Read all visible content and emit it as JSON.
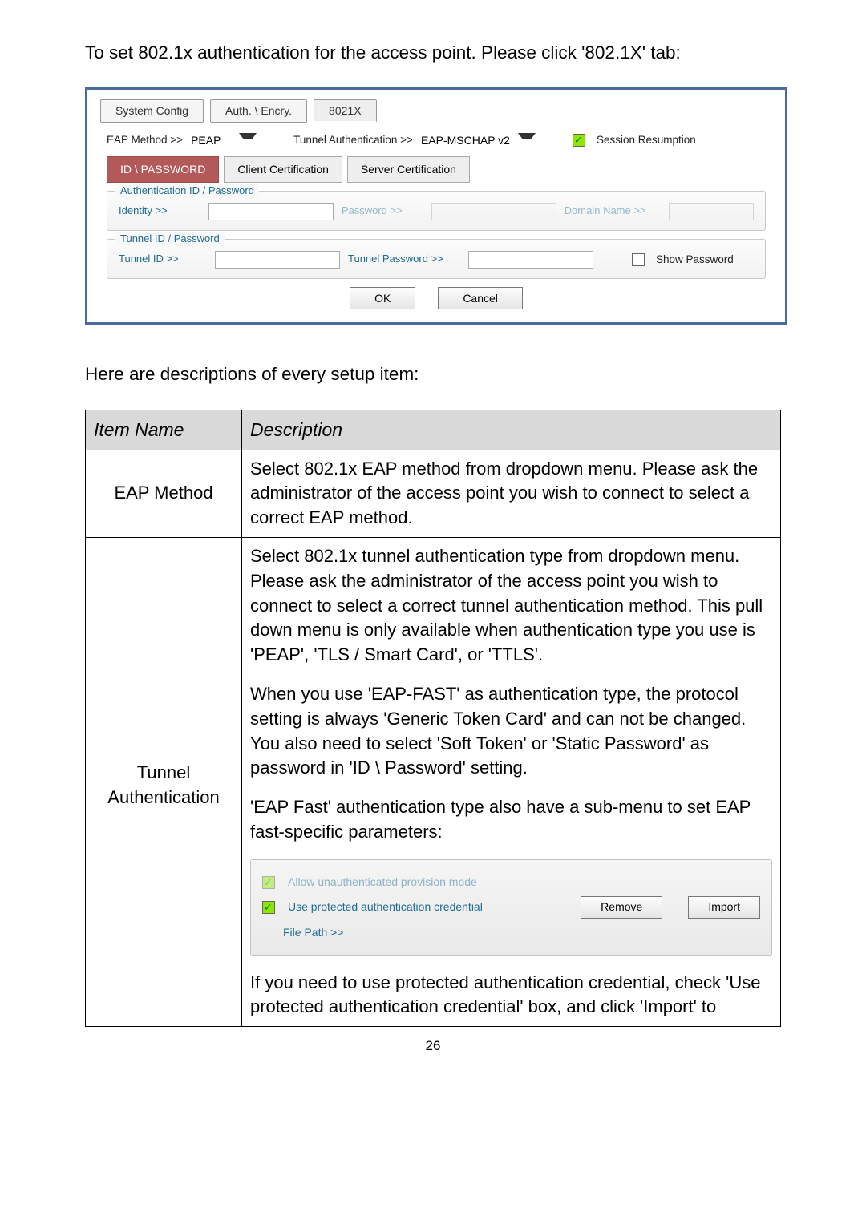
{
  "intro": "To set 802.1x authentication for the access point. Please click '802.1X' tab:",
  "panel": {
    "tabs": {
      "system": "System Config",
      "auth": "Auth. \\ Encry.",
      "x8021": "8021X"
    },
    "eap_method_label": "EAP Method >>",
    "eap_method_value": "PEAP",
    "tunnel_auth_label": "Tunnel Authentication >>",
    "tunnel_auth_value": "EAP-MSCHAP v2",
    "session_resumption_label": "Session Resumption",
    "mid_tabs": {
      "id_pw": "ID \\ PASSWORD",
      "client_cert": "Client Certification",
      "server_cert": "Server Certification"
    },
    "fieldset1": {
      "legend": "Authentication ID / Password",
      "identity_label": "Identity >>",
      "password_label": "Password >>",
      "domain_label": "Domain Name >>"
    },
    "fieldset2": {
      "legend": "Tunnel ID / Password",
      "tunnel_id_label": "Tunnel ID >>",
      "tunnel_pw_label": "Tunnel Password >>",
      "show_pw_label": "Show Password"
    },
    "ok": "OK",
    "cancel": "Cancel"
  },
  "here_are": "Here are descriptions of every setup item:",
  "table": {
    "h1": "Item Name",
    "h2": "Description",
    "row1": {
      "name": "EAP Method",
      "desc": "Select 802.1x EAP method from dropdown menu. Please ask the administrator of the access point you wish to connect to select a correct EAP method."
    },
    "row2": {
      "name": "Tunnel Authentication",
      "p1": "Select 802.1x tunnel authentication type from dropdown menu. Please ask the administrator of the access point you wish to connect to select a correct tunnel authentication method. This pull down menu is only available when authentication type you use is 'PEAP', 'TLS / Smart Card', or 'TTLS'.",
      "p2": "When you use 'EAP-FAST' as authentication type, the protocol setting is always 'Generic Token Card' and can not be changed. You also need to select 'Soft Token' or 'Static Password' as password in 'ID \\ Password' setting.",
      "p3": "'EAP Fast' authentication type also have a sub-menu to set EAP fast-specific parameters:",
      "subpanel": {
        "allow": "Allow unauthenticated provision mode",
        "use_cred": "Use protected authentication credential",
        "remove": "Remove",
        "import": "Import",
        "file_path": "File Path >>"
      },
      "p4": "If you need to use protected authentication credential, check 'Use protected authentication credential' box, and click 'Import' to"
    }
  },
  "page_num": "26"
}
